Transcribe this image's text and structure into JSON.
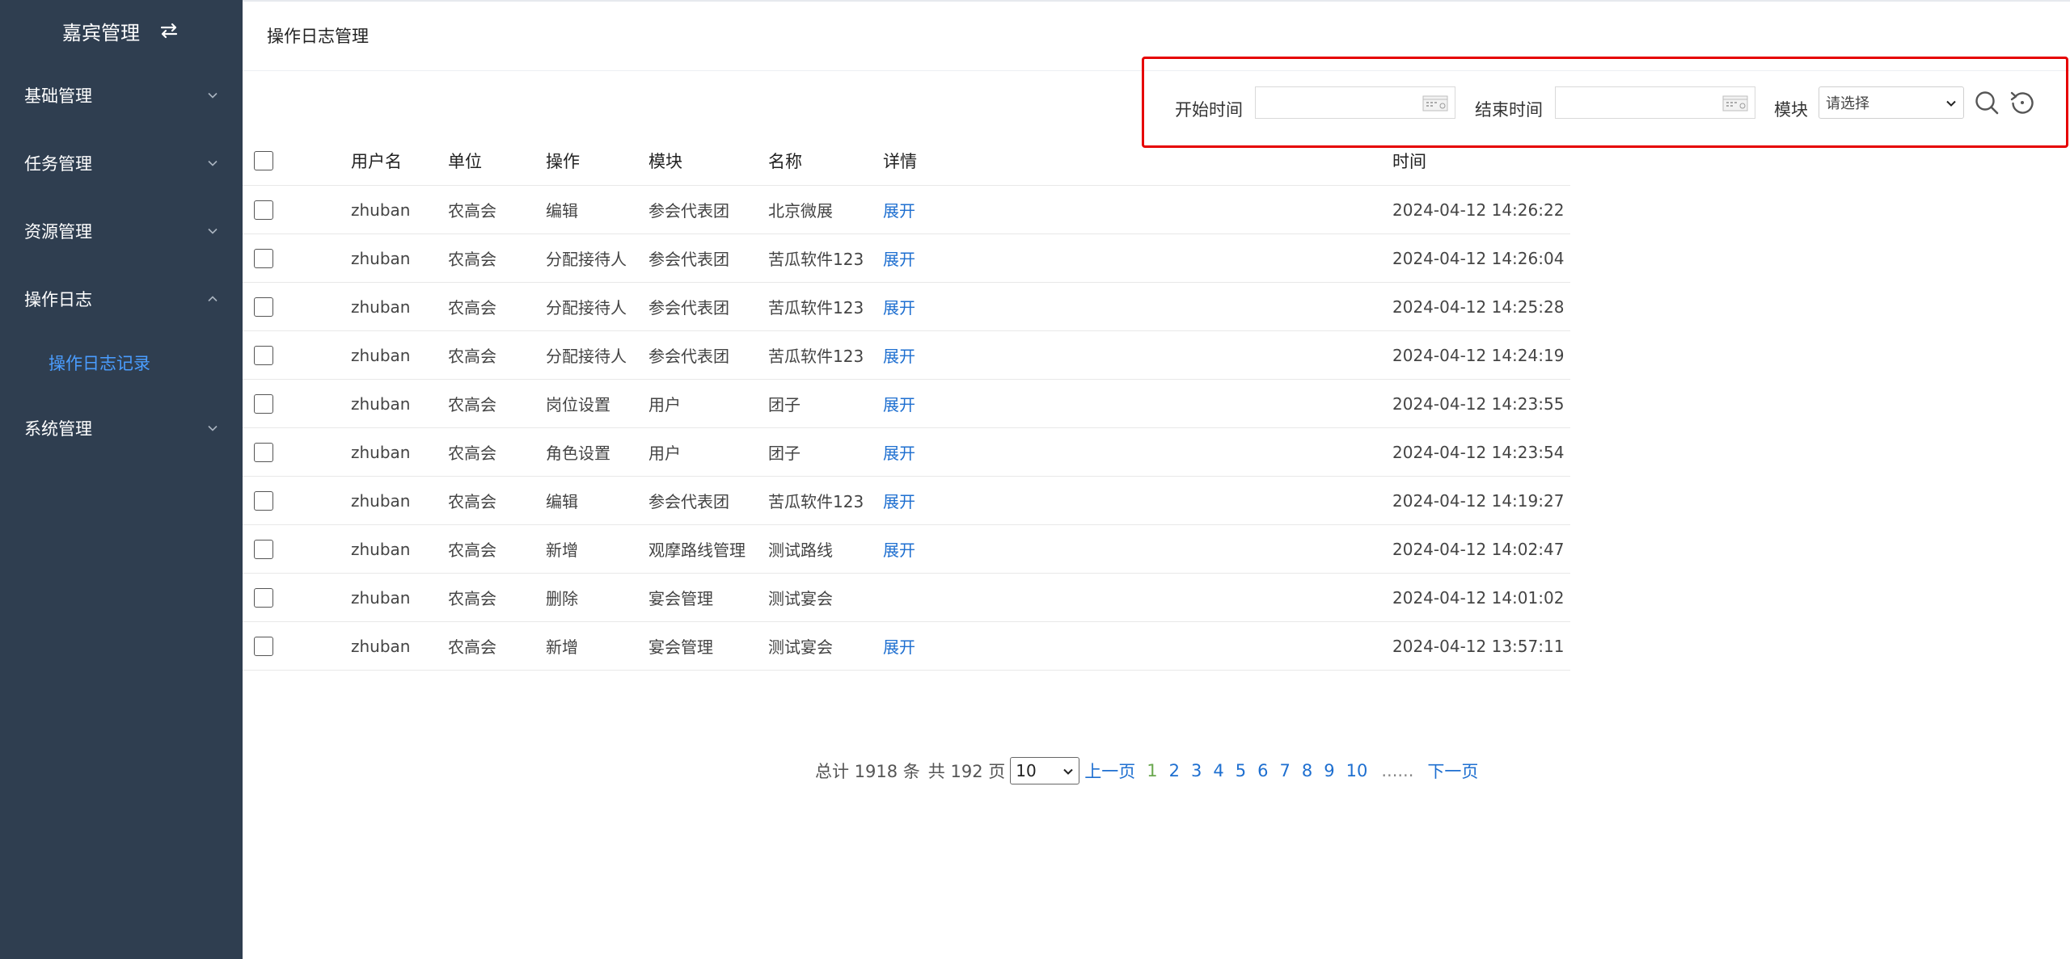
{
  "sidebar": {
    "title": "嘉宾管理",
    "menu": [
      {
        "label": "基础管理"
      },
      {
        "label": "任务管理"
      },
      {
        "label": "资源管理"
      },
      {
        "label": "操作日志"
      },
      {
        "label": "系统管理"
      }
    ],
    "submenu_active": "操作日志记录"
  },
  "header": {
    "title": "操作日志管理"
  },
  "filter": {
    "start_label": "开始时间",
    "end_label": "结束时间",
    "module_label": "模块",
    "module_value": "请选择"
  },
  "table": {
    "headers": {
      "user": "用户名",
      "unit": "单位",
      "op": "操作",
      "module": "模块",
      "name": "名称",
      "detail": "详情",
      "time": "时间"
    },
    "rows": [
      {
        "user": "zhuban",
        "unit": "农高会",
        "op": "编辑",
        "module": "参会代表团",
        "name": "北京微展",
        "detail": "展开",
        "time": "2024-04-12 14:26:22"
      },
      {
        "user": "zhuban",
        "unit": "农高会",
        "op": "分配接待人",
        "module": "参会代表团",
        "name": "苦瓜软件123",
        "detail": "展开",
        "time": "2024-04-12 14:26:04"
      },
      {
        "user": "zhuban",
        "unit": "农高会",
        "op": "分配接待人",
        "module": "参会代表团",
        "name": "苦瓜软件123",
        "detail": "展开",
        "time": "2024-04-12 14:25:28"
      },
      {
        "user": "zhuban",
        "unit": "农高会",
        "op": "分配接待人",
        "module": "参会代表团",
        "name": "苦瓜软件123",
        "detail": "展开",
        "time": "2024-04-12 14:24:19"
      },
      {
        "user": "zhuban",
        "unit": "农高会",
        "op": "岗位设置",
        "module": "用户",
        "name": "团子",
        "detail": "展开",
        "time": "2024-04-12 14:23:55"
      },
      {
        "user": "zhuban",
        "unit": "农高会",
        "op": "角色设置",
        "module": "用户",
        "name": "团子",
        "detail": "展开",
        "time": "2024-04-12 14:23:54"
      },
      {
        "user": "zhuban",
        "unit": "农高会",
        "op": "编辑",
        "module": "参会代表团",
        "name": "苦瓜软件123",
        "detail": "展开",
        "time": "2024-04-12 14:19:27"
      },
      {
        "user": "zhuban",
        "unit": "农高会",
        "op": "新增",
        "module": "观摩路线管理",
        "name": "测试路线",
        "detail": "展开",
        "time": "2024-04-12 14:02:47"
      },
      {
        "user": "zhuban",
        "unit": "农高会",
        "op": "删除",
        "module": "宴会管理",
        "name": "测试宴会",
        "detail": "",
        "time": "2024-04-12 14:01:02"
      },
      {
        "user": "zhuban",
        "unit": "农高会",
        "op": "新增",
        "module": "宴会管理",
        "name": "测试宴会",
        "detail": "展开",
        "time": "2024-04-12 13:57:11"
      }
    ]
  },
  "pagination": {
    "total_text": "总计 1918 条",
    "pages_text": "共 192 页",
    "page_size": "10",
    "prev": "上一页",
    "pages": [
      "1",
      "2",
      "3",
      "4",
      "5",
      "6",
      "7",
      "8",
      "9",
      "10"
    ],
    "current": "1",
    "ellipsis": "......",
    "next": "下一页"
  },
  "colors": {
    "sidebar_bg": "#2f3e50",
    "active_menu": "#4a9dff",
    "link": "#1e6fd0",
    "current_page": "#6aa84f",
    "highlight_border": "#e60000"
  },
  "icons": {
    "brand": "swap-icon",
    "menu": "chevron-icon",
    "search": "search-icon",
    "reset": "reset-icon",
    "date": "calendar-icon"
  }
}
